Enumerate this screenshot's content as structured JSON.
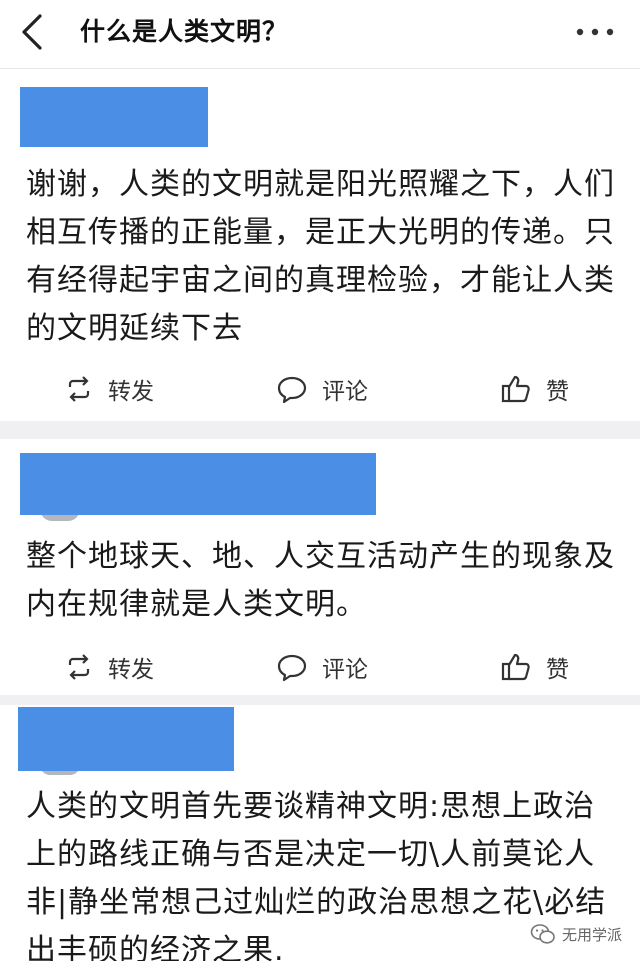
{
  "header": {
    "back_icon": "chevron-left-icon",
    "title": "什么是人类文明？",
    "more_icon": "more-dots-icon"
  },
  "answers": [
    {
      "text": "谢谢，人类的文明就是阳光照耀之下，人们相互传播的正能量，是正大光明的传递。只有经得起宇宙之间的真理检验，才能让人类的文明延续下去",
      "actions": {
        "repost": "转发",
        "comment": "评论",
        "like": "赞"
      }
    },
    {
      "text": "整个地球天、地、人交互活动产生的现象及内在规律就是人类文明。",
      "actions": {
        "repost": "转发",
        "comment": "评论",
        "like": "赞"
      }
    },
    {
      "text": "人类的文明首先要谈精神文明:思想上政治上的路线正确与否是决定一切\\人前莫论人非|静坐常想己过灿烂的政治思想之花\\必结出丰硕的经济之果."
    }
  ],
  "watermark": {
    "text": "无用学派",
    "icon": "wechat-icon"
  },
  "colors": {
    "redaction": "#4a8ee6",
    "separator": "#f0f0f2"
  }
}
